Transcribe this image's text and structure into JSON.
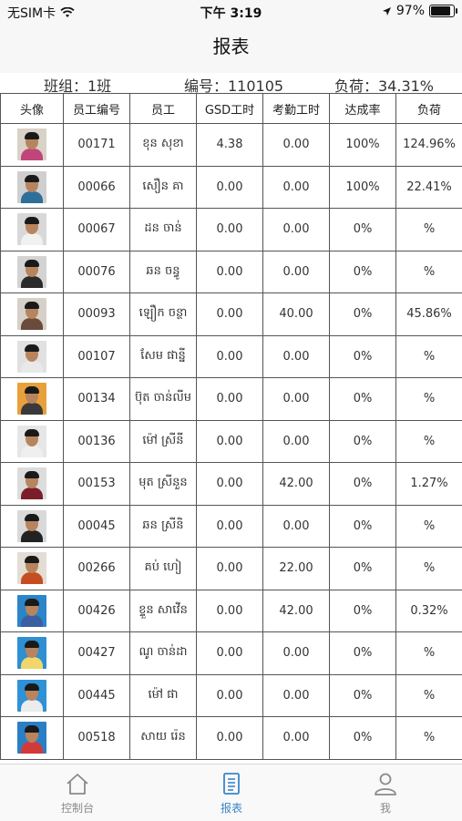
{
  "status": {
    "carrier": "无SIM卡",
    "time": "下午 3:19",
    "battery": "97%",
    "battery_level": 0.97
  },
  "nav": {
    "title": "报表"
  },
  "info": {
    "group": "班组：1班",
    "code": "编号：110105",
    "load": "负荷：34.31%"
  },
  "table": {
    "headers": [
      "头像",
      "员工编号",
      "员工",
      "GSD工时",
      "考勤工时",
      "达成率",
      "负荷"
    ],
    "rows": [
      {
        "id": "00171",
        "name": "ខុន សុខា",
        "gsd": "4.38",
        "att": "0.00",
        "rate": "100%",
        "load": "124.96%",
        "bg": "#d9d2c8",
        "shirt": "#c2457a"
      },
      {
        "id": "00066",
        "name": "សឿន គា",
        "gsd": "0.00",
        "att": "0.00",
        "rate": "100%",
        "load": "22.41%",
        "bg": "#cfcfcf",
        "shirt": "#2e6f99"
      },
      {
        "id": "00067",
        "name": "ដន ចាន់",
        "gsd": "0.00",
        "att": "0.00",
        "rate": "0%",
        "load": "%",
        "bg": "#d8d8d8",
        "shirt": "#f1f1f1"
      },
      {
        "id": "00076",
        "name": "ឆន ចន្ធូ",
        "gsd": "0.00",
        "att": "0.00",
        "rate": "0%",
        "load": "%",
        "bg": "#d3d3d3",
        "shirt": "#2b2b2b"
      },
      {
        "id": "00093",
        "name": "ឡឿក ចន្ថា",
        "gsd": "0.00",
        "att": "40.00",
        "rate": "0%",
        "load": "45.86%",
        "bg": "#d6d0c9",
        "shirt": "#6a4a3a"
      },
      {
        "id": "00107",
        "name": "សែម ផាន្នី",
        "gsd": "0.00",
        "att": "0.00",
        "rate": "0%",
        "load": "%",
        "bg": "#e1e1e1",
        "shirt": "#e9e9e9"
      },
      {
        "id": "00134",
        "name": "ប៊ុត ចាន់លីម",
        "gsd": "0.00",
        "att": "0.00",
        "rate": "0%",
        "load": "%",
        "bg": "#e8a13a",
        "shirt": "#3a3a3a"
      },
      {
        "id": "00136",
        "name": "ម៉ៅ ស្រីនី",
        "gsd": "0.00",
        "att": "0.00",
        "rate": "0%",
        "load": "%",
        "bg": "#e6e6e6",
        "shirt": "#efefef"
      },
      {
        "id": "00153",
        "name": "មុត ស្រីនួន",
        "gsd": "0.00",
        "att": "42.00",
        "rate": "0%",
        "load": "1.27%",
        "bg": "#dcdcdc",
        "shirt": "#7a1f2a"
      },
      {
        "id": "00045",
        "name": "ឆន ស្រីនិ",
        "gsd": "0.00",
        "att": "0.00",
        "rate": "0%",
        "load": "%",
        "bg": "#d9d9d9",
        "shirt": "#222222"
      },
      {
        "id": "00266",
        "name": "គប់ ហៀ",
        "gsd": "0.00",
        "att": "22.00",
        "rate": "0%",
        "load": "%",
        "bg": "#e3ddd4",
        "shirt": "#c44e22"
      },
      {
        "id": "00426",
        "name": "ខ្ទួន សាវើន",
        "gsd": "0.00",
        "att": "42.00",
        "rate": "0%",
        "load": "0.32%",
        "bg": "#2c84c9",
        "shirt": "#3b5fa0"
      },
      {
        "id": "00427",
        "name": "ណូ ចាន់ដា",
        "gsd": "0.00",
        "att": "0.00",
        "rate": "0%",
        "load": "%",
        "bg": "#2e8fd3",
        "shirt": "#f2d66b"
      },
      {
        "id": "00445",
        "name": "ម៉ៅ ផា",
        "gsd": "0.00",
        "att": "0.00",
        "rate": "0%",
        "load": "%",
        "bg": "#2f91d6",
        "shirt": "#ececec"
      },
      {
        "id": "00518",
        "name": "សាយ រ៉េន",
        "gsd": "0.00",
        "att": "0.00",
        "rate": "0%",
        "load": "%",
        "bg": "#2a7fc4",
        "shirt": "#d23a3a"
      }
    ]
  },
  "tabs": [
    {
      "label": "控制台",
      "icon": "home-icon"
    },
    {
      "label": "报表",
      "icon": "report-icon"
    },
    {
      "label": "我",
      "icon": "user-icon"
    }
  ],
  "colors": {
    "accent": "#3a86c8",
    "inactive": "#8a8a8a"
  }
}
